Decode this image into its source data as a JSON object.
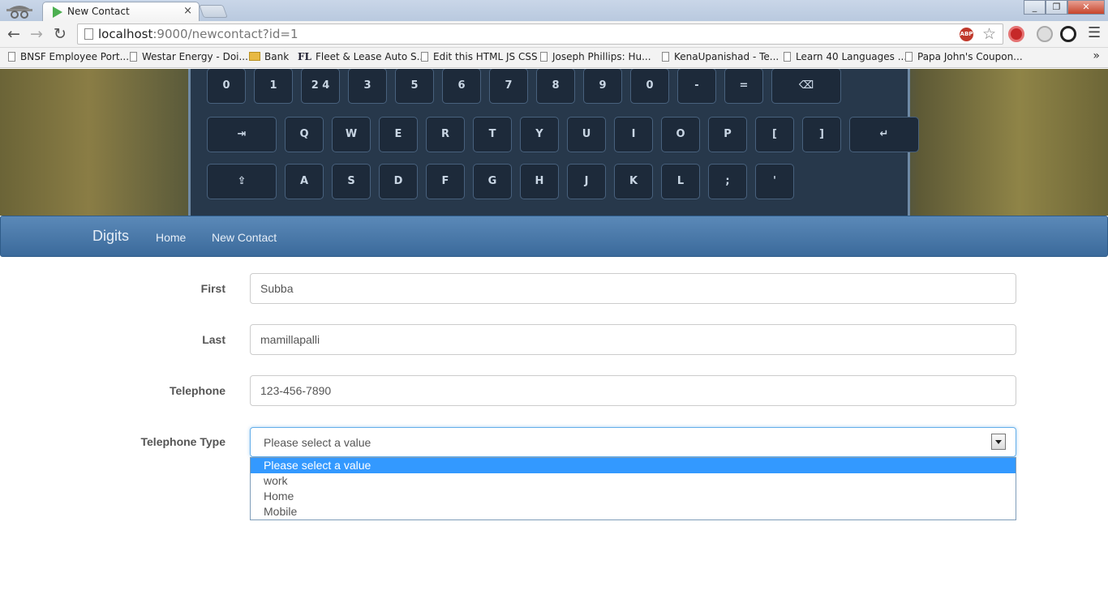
{
  "browser": {
    "tab_title": "New Contact",
    "tab_close": "×",
    "url_host": "localhost",
    "url_path": ":9000/newcontact?id=1",
    "abp_badge": "ABP",
    "bookmarks": [
      {
        "label": "BNSF Employee Port...",
        "icon": "page-icon"
      },
      {
        "label": "Westar Energy - Doi...",
        "icon": "page-icon"
      },
      {
        "label": "Bank",
        "icon": "folder-icon"
      },
      {
        "label": "Fleet & Lease Auto S...",
        "icon": "fl-icon",
        "prefix": "FL"
      },
      {
        "label": "Edit this HTML JS CSS",
        "icon": "page-icon"
      },
      {
        "label": "Joseph Phillips: Hu...",
        "icon": "page-icon"
      },
      {
        "label": "KenaUpanishad - Te...",
        "icon": "page-icon"
      },
      {
        "label": "Learn 40 Languages ...",
        "icon": "page-icon"
      },
      {
        "label": "Papa John's Coupon...",
        "icon": "page-icon"
      }
    ],
    "bookmarks_more": "»"
  },
  "hero": {
    "row1": [
      "0",
      "1",
      "2 4",
      "3",
      "5",
      "6",
      "7",
      "8",
      "9",
      "0",
      "-",
      "=",
      "⌫"
    ],
    "row2": [
      "⇥",
      "Q",
      "W",
      "E",
      "R",
      "T",
      "Y",
      "U",
      "I",
      "O",
      "P",
      "[",
      "]",
      "↵"
    ],
    "row3": [
      "⇪",
      "A",
      "S",
      "D",
      "F",
      "G",
      "H",
      "J",
      "K",
      "L",
      ";",
      "'"
    ]
  },
  "navbar": {
    "brand": "Digits",
    "links": [
      "Home",
      "New Contact"
    ]
  },
  "form": {
    "first_label": "First",
    "first_value": "Subba",
    "last_label": "Last",
    "last_value": "mamillapalli",
    "telephone_label": "Telephone",
    "telephone_value": "123-456-7890",
    "type_label": "Telephone Type",
    "type_selected": "Please select a value",
    "type_options": [
      "Please select a value",
      "work",
      "Home",
      "Mobile"
    ]
  },
  "colors": {
    "navbar_top": "#5b89b8",
    "navbar_bottom": "#3b6a9b",
    "option_highlight": "#3399ff",
    "select_focus": "#66afe9"
  }
}
